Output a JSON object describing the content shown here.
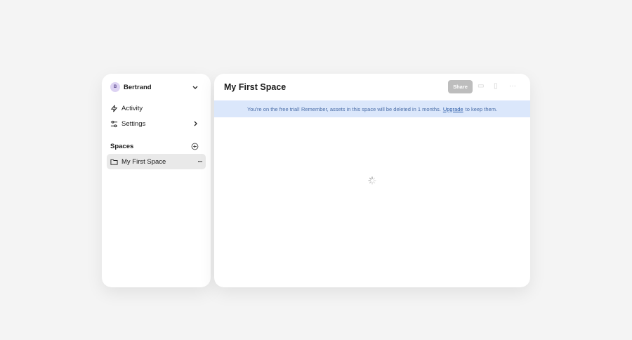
{
  "sidebar": {
    "user": {
      "initial": "B",
      "name": "Bertrand"
    },
    "items": [
      {
        "label": "Activity"
      },
      {
        "label": "Settings"
      }
    ],
    "spaces_heading": "Spaces",
    "spaces": [
      {
        "label": "My First Space"
      }
    ]
  },
  "main": {
    "title": "My First Space",
    "share_label": "Share",
    "banner": {
      "text": "You're on the free trial! Remember, assets in this space will be deleted in 1 months.",
      "link": "Upgrade",
      "suffix": "to keep them."
    }
  },
  "colors": {
    "banner_bg": "#dbe7fb",
    "accent": "#2f5ea8"
  }
}
